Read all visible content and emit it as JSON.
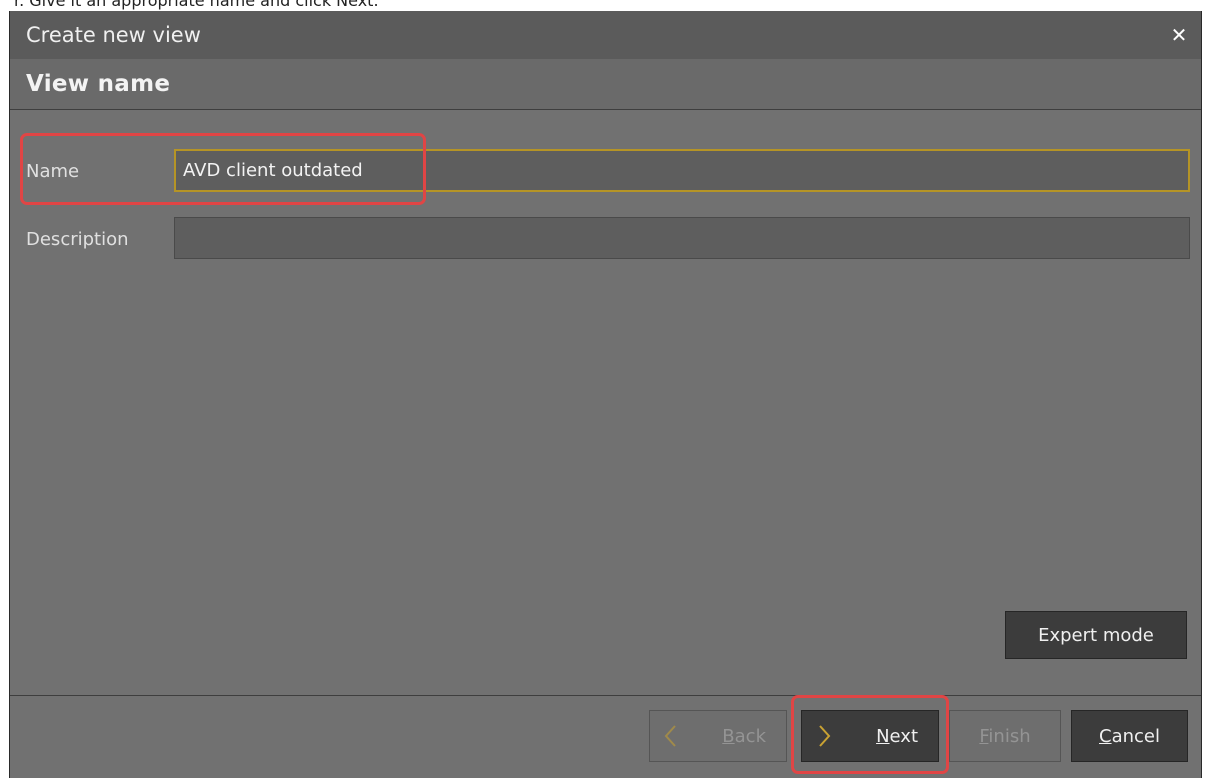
{
  "top_strip_text": "r. Give it an appropriate name and click Next.",
  "dialog": {
    "title": "Create new view",
    "close_icon": "close-icon",
    "section_title": "View name"
  },
  "form": {
    "name_label": "Name",
    "name_value": "AVD client outdated",
    "description_label": "Description",
    "description_value": ""
  },
  "buttons": {
    "expert_mode": "Expert mode",
    "back": {
      "mnemonic": "B",
      "rest": "ack",
      "enabled": false,
      "icon": "chevron-left-icon"
    },
    "next": {
      "mnemonic": "N",
      "rest": "ext",
      "enabled": true,
      "icon": "chevron-right-icon"
    },
    "finish": {
      "mnemonic": "F",
      "rest": "inish",
      "enabled": false
    },
    "cancel": {
      "mnemonic": "C",
      "rest": "ancel",
      "enabled": true
    }
  },
  "colors": {
    "dialog_bg": "#717171",
    "title_bar": "#5b5b5b",
    "focus_border": "#b59426",
    "highlight": "#e04545",
    "chevron": "#c9a233"
  }
}
